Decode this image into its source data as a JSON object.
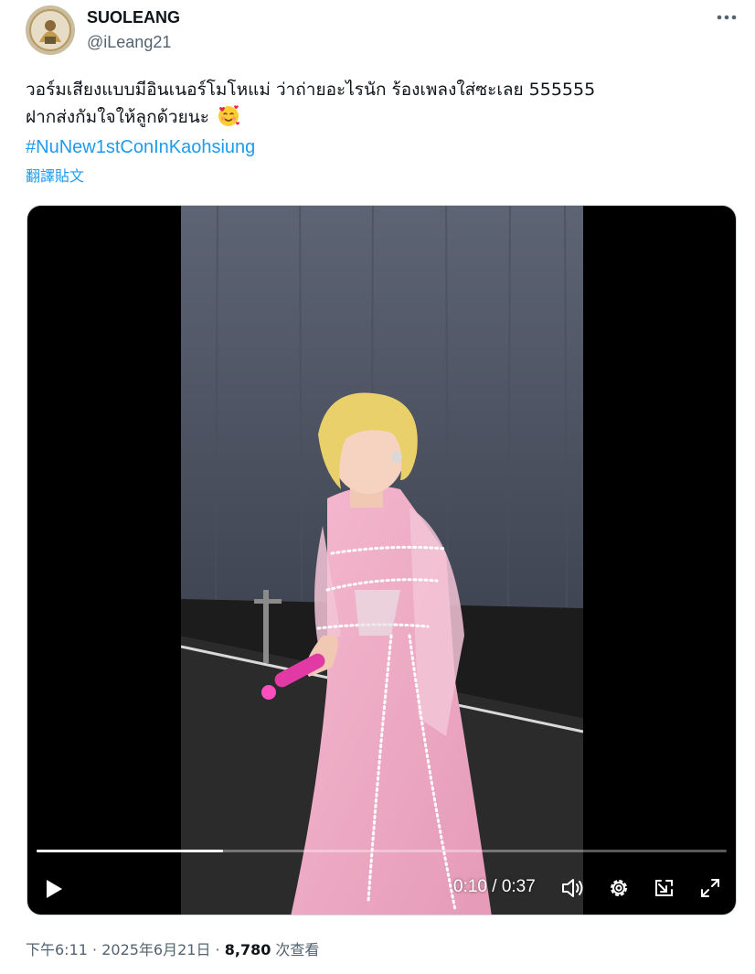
{
  "user": {
    "display_name": "SUOLEANG",
    "handle": "@iLeang21"
  },
  "tweet": {
    "line1": "วอร์มเสียงแบบมีอินเนอร์โมโหแม่ ว่าถ่ายอะไรนัก  ร้องเพลงใส่ซะเลย 555555",
    "line2": "ฝากส่งกัมใจให้ลูกด้วยนะ",
    "emoji": "smiling-face-with-hearts",
    "hashtag": "#NuNew1stConInKaohsiung",
    "translate_label": "翻譯貼文"
  },
  "video": {
    "current_time": "0:10",
    "separator": " / ",
    "duration": "0:37",
    "progress": 0.27,
    "icons": [
      "play-icon",
      "volume-icon",
      "settings-icon",
      "picture-in-picture-icon",
      "fullscreen-icon"
    ]
  },
  "meta": {
    "time": "下午6:11",
    "dot1": " · ",
    "date": "2025年6月21日",
    "dot2": " · ",
    "views_count": "8,780",
    "views_label": " 次查看"
  },
  "colors": {
    "link": "#1d9bf0",
    "secondary_text": "#536471",
    "primary_text": "#0f1419"
  }
}
